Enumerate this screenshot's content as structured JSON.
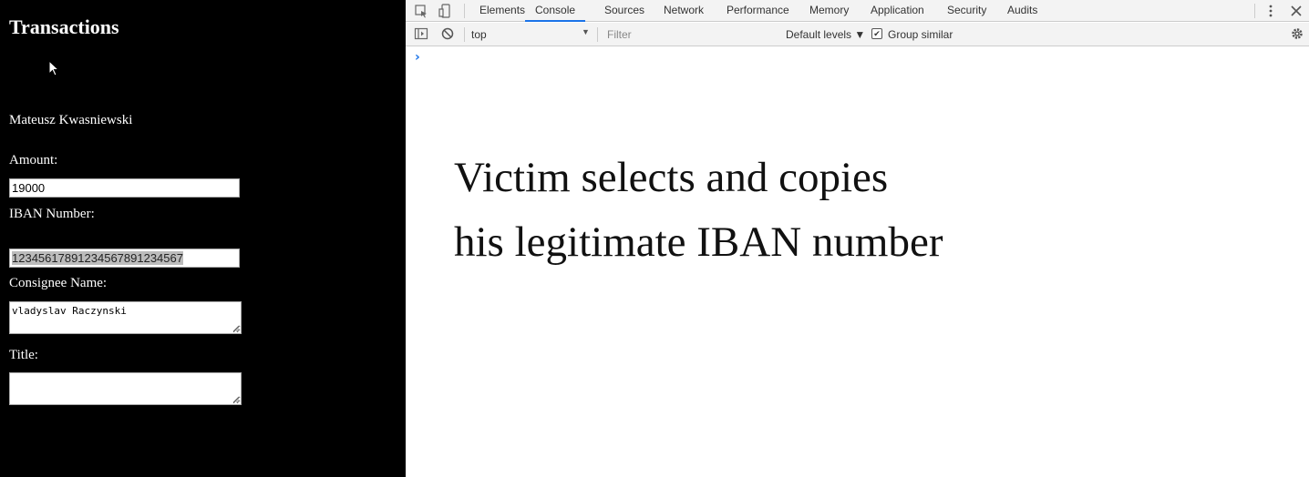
{
  "page": {
    "title": "Transactions",
    "user_name": "Mateusz Kwasniewski",
    "amount_label": "Amount:",
    "amount_value": "19000",
    "iban_label": "IBAN Number:",
    "iban_value": "12345617891234567891234567",
    "consignee_label": "Consignee Name:",
    "consignee_value": "vladyslav Raczynski",
    "title_label": "Title:",
    "title_value": ""
  },
  "devtools": {
    "tabs": [
      "Elements",
      "Console",
      "Sources",
      "Network",
      "Performance",
      "Memory",
      "Application",
      "Security",
      "Audits"
    ],
    "active_tab": "Console",
    "context": "top",
    "filter_placeholder": "Filter",
    "levels": "Default levels ▼",
    "group_similar": "Group similar",
    "prompt": "›"
  },
  "caption": {
    "line1": "Victim selects and copies",
    "line2": "his legitimate IBAN number"
  },
  "colors": {
    "page_bg": "#000000",
    "active_tab_underline": "#1a73e8",
    "selection": "#bcbcbc"
  }
}
